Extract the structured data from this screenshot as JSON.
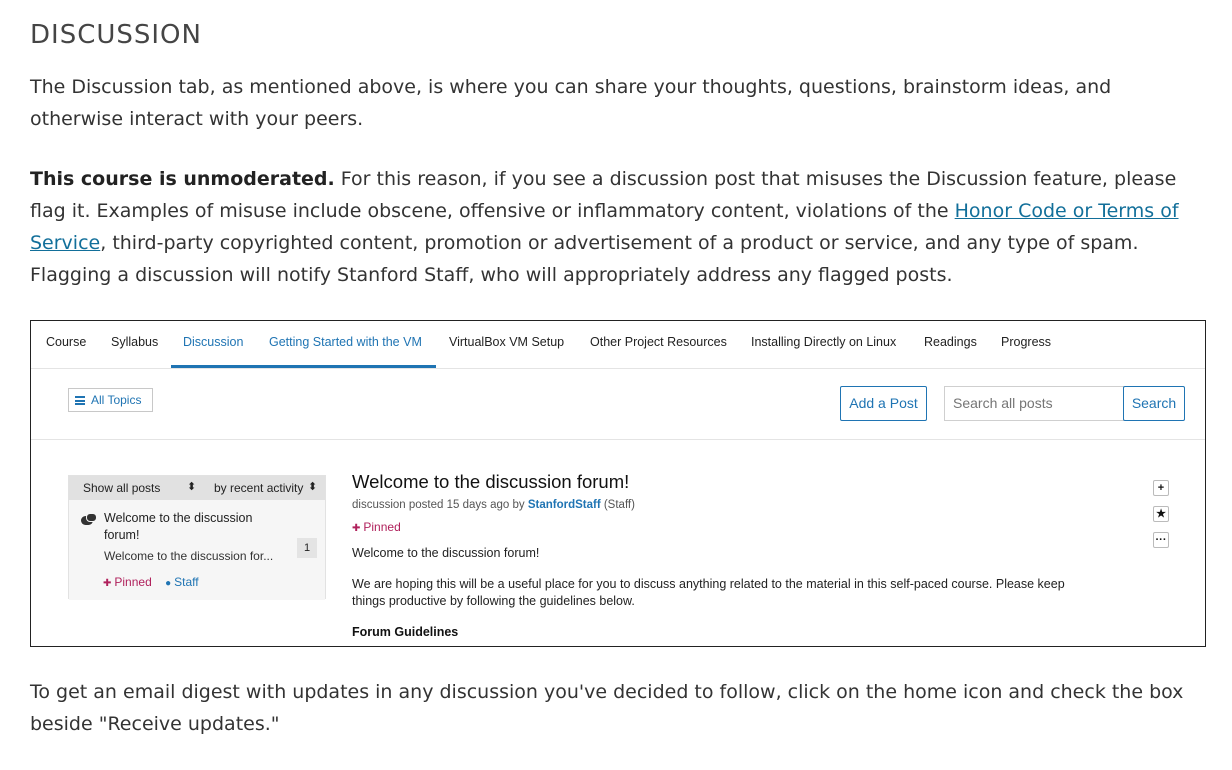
{
  "heading": "DISCUSSION",
  "para1": "The Discussion tab, as mentioned above, is where you can share your thoughts, questions, brainstorm ideas, and otherwise interact with your peers.",
  "para2": {
    "bold": "This course is unmoderated.",
    "before_link": " For this reason, if you see a discussion post that misuses the Discussion feature, please flag it. Examples of misuse include obscene, offensive or inflammatory content, violations of the ",
    "link": "Honor Code or Terms of Service",
    "after_link": ", third-party copyrighted content, promotion or advertisement of a product or service, and any type of spam. Flagging a discussion will notify Stanford Staff, who will appropriately address any flagged posts."
  },
  "para3": "To get an email digest with updates in any discussion you've decided to follow, click on the home icon and check the box beside \"Receive updates.\"",
  "screenshot": {
    "tabs": [
      "Course",
      "Syllabus",
      "Discussion",
      "Getting Started with the VM",
      "VirtualBox VM Setup",
      "Other Project Resources",
      "Installing Directly on Linux",
      "Readings",
      "Progress"
    ],
    "active_tab": "Discussion",
    "all_topics": "All Topics",
    "add_post": "Add a Post",
    "search_placeholder": "Search all posts",
    "search_button": "Search",
    "sort": {
      "filter": "Show all posts",
      "order": "by recent activity"
    },
    "thread": {
      "title": "Welcome to the discussion forum!",
      "preview": "Welcome to the discussion for...",
      "count": "1",
      "pinned": "Pinned",
      "staff": "Staff"
    },
    "post": {
      "title": "Welcome to the discussion forum!",
      "meta_prefix": "discussion posted 15 days ago by ",
      "author": "StanfordStaff",
      "role": " (Staff)",
      "pinned": "Pinned",
      "body1": "Welcome to the discussion forum!",
      "body2": "We are hoping this will be a useful place for you to discuss anything related to the material in this self-paced course. Please keep things productive by following the guidelines below.",
      "body3": "Forum Guidelines"
    },
    "actions": {
      "add": "+",
      "star": "★",
      "more": "···"
    }
  }
}
